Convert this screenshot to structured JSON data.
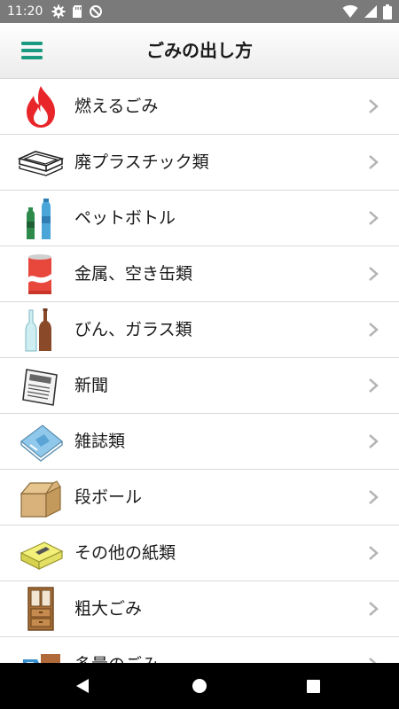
{
  "status_bar": {
    "time": "11:20",
    "left_icons": [
      "gear-icon",
      "sd-card-icon",
      "no-sync-icon"
    ],
    "right_icons": [
      "wifi-icon",
      "signal-icon",
      "battery-icon"
    ]
  },
  "app_bar": {
    "title": "ごみの出し方",
    "menu_icon": "hamburger-menu-icon",
    "accent_color": "#1a9a80"
  },
  "items": [
    {
      "label": "燃えるごみ",
      "icon": "fire-icon"
    },
    {
      "label": "廃プラスチック類",
      "icon": "plastic-tray-icon"
    },
    {
      "label": "ペットボトル",
      "icon": "pet-bottle-icon"
    },
    {
      "label": "金属、空き缶類",
      "icon": "can-icon"
    },
    {
      "label": "びん、ガラス類",
      "icon": "glass-bottle-icon"
    },
    {
      "label": "新聞",
      "icon": "newspaper-icon"
    },
    {
      "label": "雑誌類",
      "icon": "magazine-icon"
    },
    {
      "label": "段ボール",
      "icon": "cardboard-box-icon"
    },
    {
      "label": "その他の紙類",
      "icon": "tissue-box-icon"
    },
    {
      "label": "粗大ごみ",
      "icon": "cabinet-icon"
    },
    {
      "label": "多量のごみ",
      "icon": "truck-icon"
    }
  ],
  "nav_bar": {
    "back": "back-icon",
    "home": "home-icon",
    "recents": "recents-icon"
  }
}
